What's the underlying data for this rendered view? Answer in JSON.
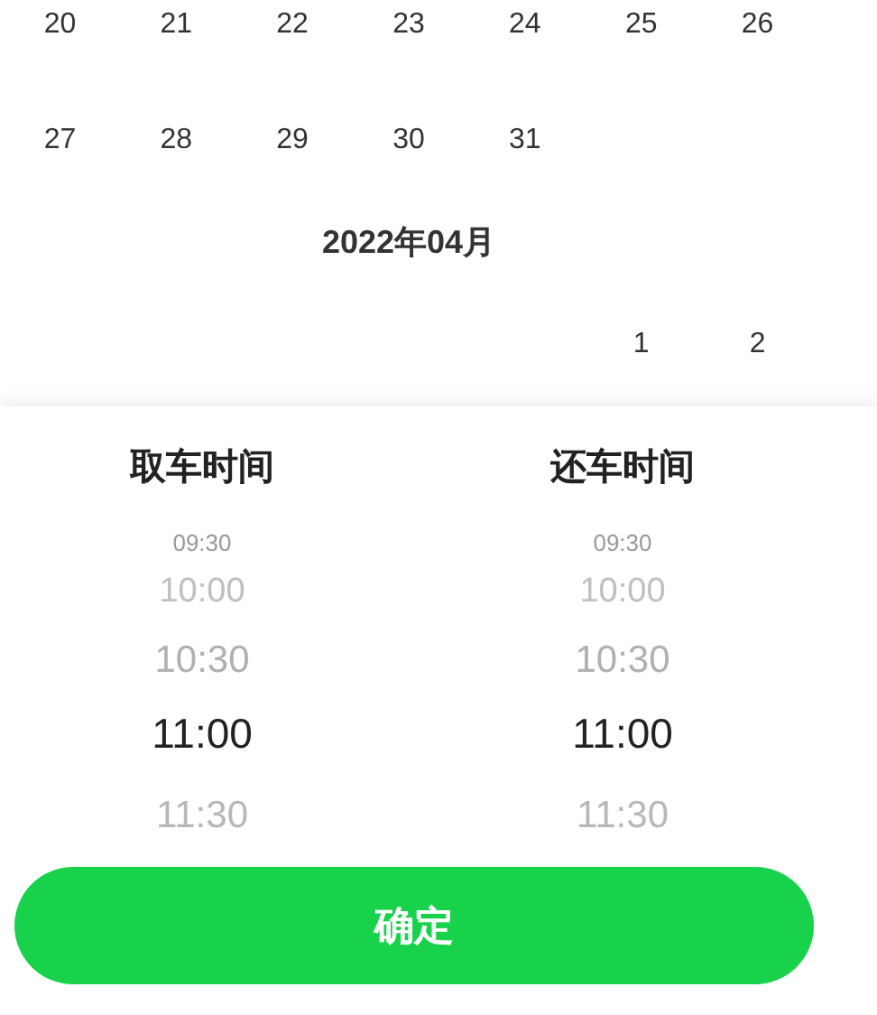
{
  "calendar": {
    "months": [
      {
        "weeks": [
          [
            "20",
            "21",
            "22",
            "23",
            "24",
            "25",
            "26"
          ],
          [
            "27",
            "28",
            "29",
            "30",
            "31"
          ]
        ]
      },
      {
        "title": "2022年04月",
        "weeks": [
          [
            {
              "kind": "blank"
            },
            {
              "kind": "blank"
            },
            {
              "kind": "blank"
            },
            {
              "kind": "blank"
            },
            {
              "kind": "blank"
            },
            "1",
            "2"
          ]
        ]
      }
    ]
  },
  "picker": {
    "columns": [
      {
        "title": "取车时间",
        "options": [
          {
            "label": "09:30",
            "selected": false
          },
          {
            "label": "10:00",
            "selected": false
          },
          {
            "label": "10:30",
            "selected": false
          },
          {
            "label": "11:00",
            "selected": true
          },
          {
            "label": "11:30",
            "selected": false
          }
        ]
      },
      {
        "title": "还车时间",
        "options": [
          {
            "label": "09:30",
            "selected": false
          },
          {
            "label": "10:00",
            "selected": false
          },
          {
            "label": "10:30",
            "selected": false
          },
          {
            "label": "11:00",
            "selected": true
          },
          {
            "label": "11:30",
            "selected": false
          }
        ]
      }
    ]
  },
  "confirm_button": "确定"
}
